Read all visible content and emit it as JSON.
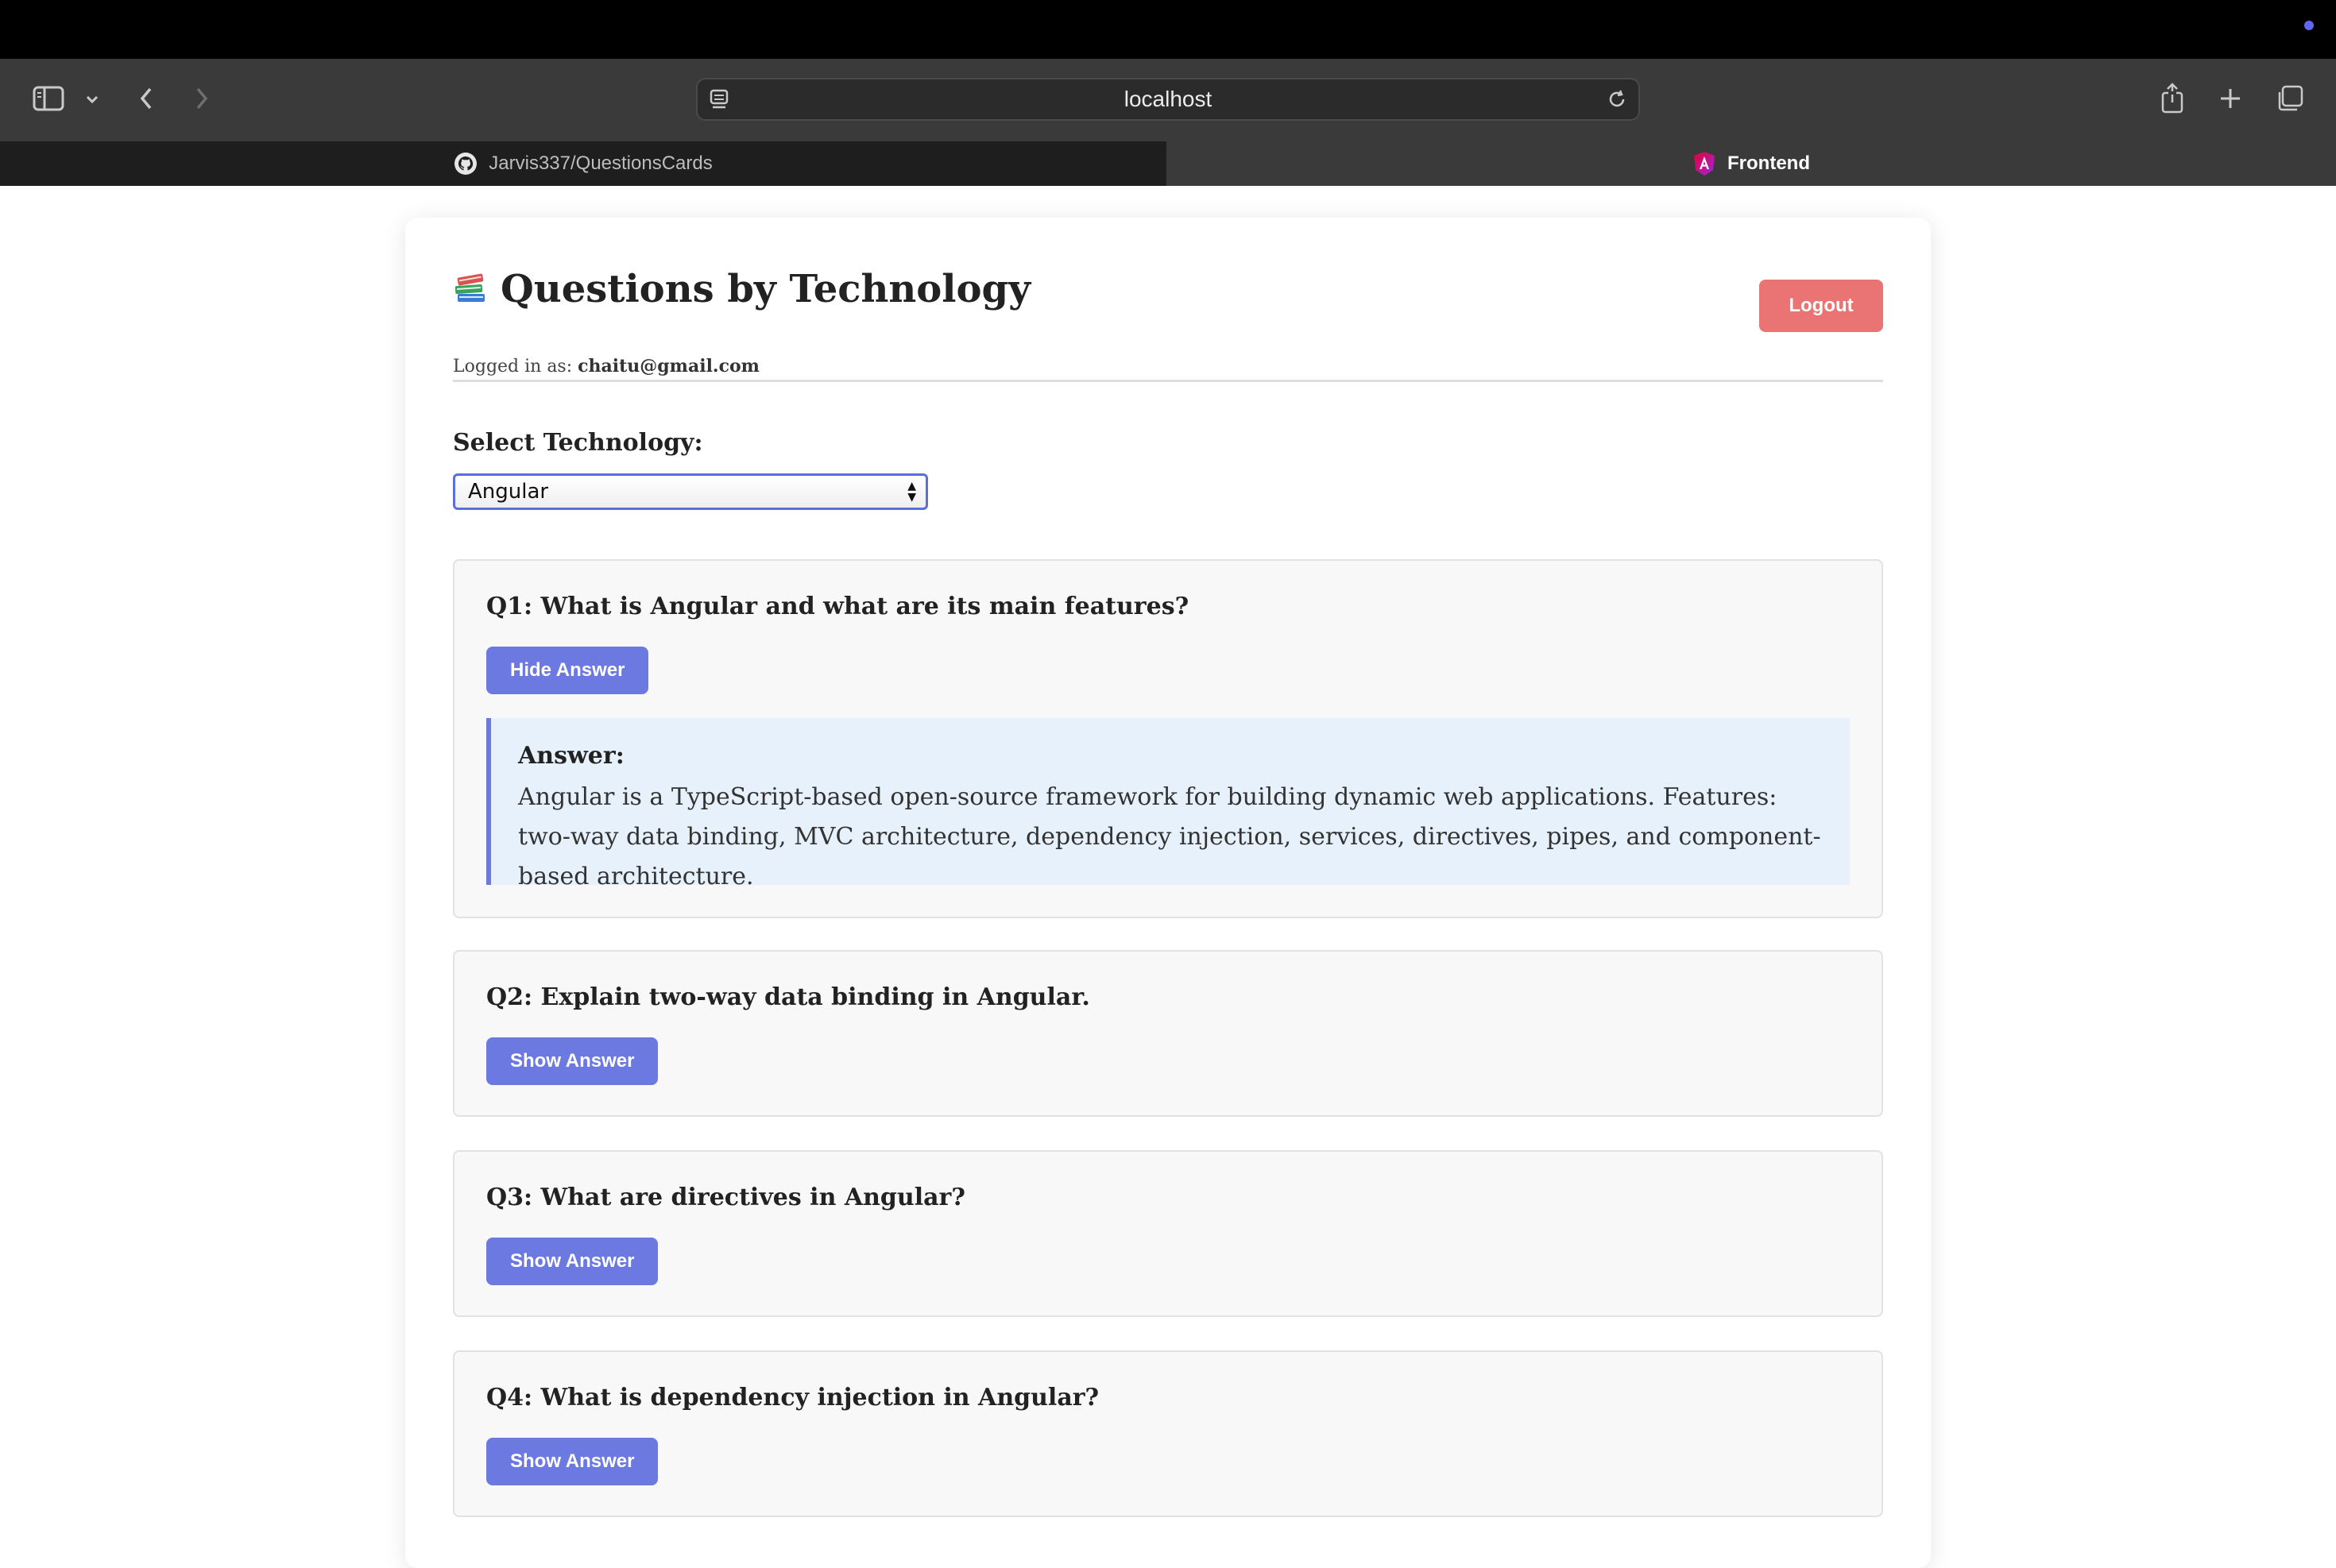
{
  "browser": {
    "url": "localhost",
    "tabs": [
      {
        "label": "Jarvis337/QuestionsCards",
        "icon": "github-icon",
        "active": false
      },
      {
        "label": "Frontend",
        "icon": "angular-icon",
        "active": true
      }
    ]
  },
  "header": {
    "title": "Questions by Technology",
    "logged_in_prefix": "Logged in as:",
    "user_email": "chaitu@gmail.com",
    "logout_label": "Logout"
  },
  "selector": {
    "label": "Select Technology:",
    "value": "Angular"
  },
  "questions": [
    {
      "title": "Q1: What is Angular and what are its main features?",
      "button_label": "Hide Answer",
      "answer_label": "Answer:",
      "answer_text": "Angular is a TypeScript-based open-source framework for building dynamic web applications. Features: two-way data binding, MVC architecture, dependency injection, services, directives, pipes, and component-based architecture."
    },
    {
      "title": "Q2: Explain two-way data binding in Angular.",
      "button_label": "Show Answer"
    },
    {
      "title": "Q3: What are directives in Angular?",
      "button_label": "Show Answer"
    },
    {
      "title": "Q4: What is dependency injection in Angular?",
      "button_label": "Show Answer"
    }
  ],
  "colors": {
    "primary_button": "#6c79e0",
    "logout_button": "#ea7474",
    "answer_bg": "#e6f1fb"
  }
}
